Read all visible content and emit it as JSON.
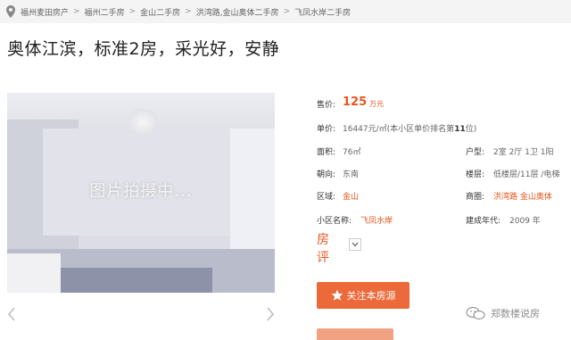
{
  "breadcrumb": {
    "items": [
      "福州麦田房产",
      "福州二手房",
      "金山二手房",
      "洪湾路,金山奥体二手房",
      "飞凤水岸二手房"
    ],
    "separator": ">"
  },
  "listing": {
    "title": "奥体江滨，标准2房，采光好，安静"
  },
  "gallery": {
    "placeholder_text": "图片拍摄中...",
    "prev_icon": "chevron-left-icon",
    "next_icon": "chevron-right-icon"
  },
  "details": {
    "price_label": "售价:",
    "price_value": "125",
    "price_unit": "万元",
    "unit_price_label": "单价:",
    "unit_price_value": "16447元/㎡(本小区单价排名第",
    "unit_price_rank": "11",
    "unit_price_suffix": "位)",
    "area_label": "面积:",
    "area_value": "76㎡",
    "layout_label": "户型:",
    "layout_value": "2室 2厅 1卫 1阳",
    "orientation_label": "朝向:",
    "orientation_value": "东南",
    "floor_label": "楼层:",
    "floor_value": "低楼层/11层 /电梯",
    "district_label": "区域:",
    "district_value": "金山",
    "business_label": "商圈:",
    "business_value": "洪湾路 金山奥体",
    "community_label": "小区名称:",
    "community_value": "飞凤水岸",
    "year_label": "建成年代:",
    "year_value": "2009 年",
    "review_label": "房评"
  },
  "actions": {
    "follow_label": "关注本房源",
    "follow_icon": "star-icon"
  },
  "watermark": {
    "text": "郑数楼说房",
    "icon": "wechat-icon"
  },
  "colors": {
    "accent": "#e8561c",
    "button": "#ec6a3a",
    "breadcrumb_bg": "#f4f4f4"
  }
}
